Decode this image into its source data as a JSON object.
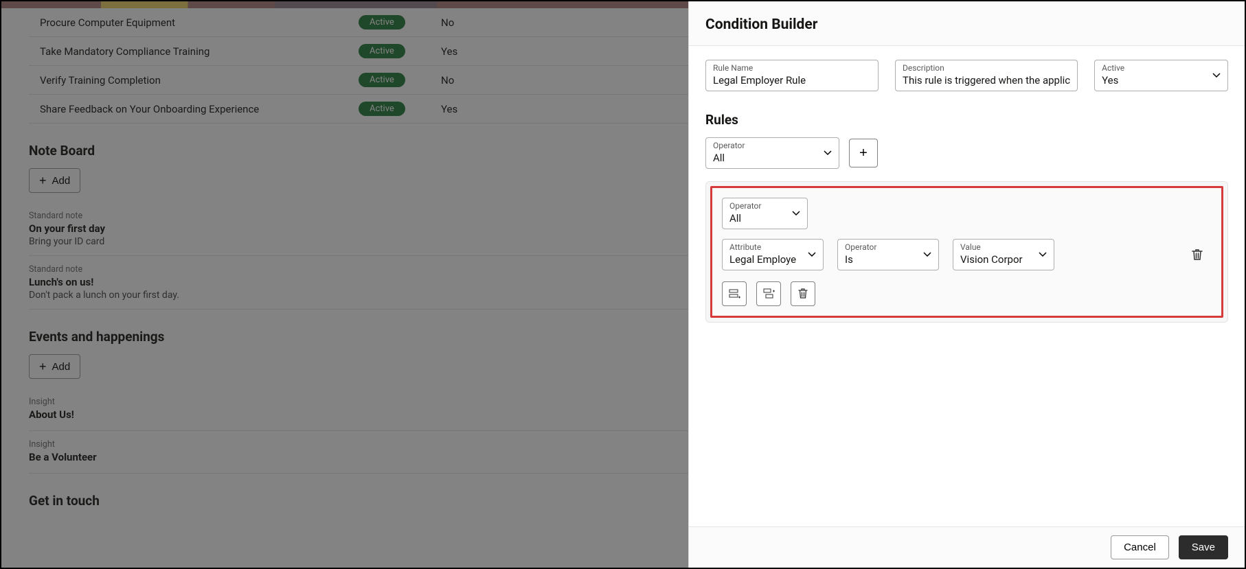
{
  "background": {
    "tasks": [
      {
        "name": "Procure Computer Equipment",
        "badge": "Active",
        "yn": "No"
      },
      {
        "name": "Take Mandatory Compliance Training",
        "badge": "Active",
        "yn": "Yes"
      },
      {
        "name": "Verify Training Completion",
        "badge": "Active",
        "yn": "No"
      },
      {
        "name": "Share Feedback on Your Onboarding Experience",
        "badge": "Active",
        "yn": "Yes"
      }
    ],
    "noteboard": {
      "title": "Note Board",
      "add": "Add",
      "items": [
        {
          "type": "Standard note",
          "title": "On your first day",
          "desc": "Bring your ID card"
        },
        {
          "type": "Standard note",
          "title": "Lunch's on us!",
          "desc": "Don't pack a lunch on your first day."
        }
      ]
    },
    "events": {
      "title": "Events and happenings",
      "add": "Add",
      "items": [
        {
          "type": "Insight",
          "title": "About Us!"
        },
        {
          "type": "Insight",
          "title": "Be a Volunteer"
        }
      ]
    },
    "getintouch": {
      "title": "Get in touch"
    }
  },
  "panel": {
    "title": "Condition Builder",
    "fields": {
      "ruleName": {
        "label": "Rule Name",
        "value": "Legal Employer Rule"
      },
      "description": {
        "label": "Description",
        "value": "This rule is triggered when the applic"
      },
      "active": {
        "label": "Active",
        "value": "Yes"
      }
    },
    "rules": {
      "title": "Rules",
      "operatorTop": {
        "label": "Operator",
        "value": "All"
      },
      "group": {
        "operator": {
          "label": "Operator",
          "value": "All"
        },
        "condition": {
          "attribute": {
            "label": "Attribute",
            "value": "Legal Employe"
          },
          "operator": {
            "label": "Operator",
            "value": "Is"
          },
          "value": {
            "label": "Value",
            "value": "Vision Corpor"
          }
        }
      }
    },
    "footer": {
      "cancel": "Cancel",
      "save": "Save"
    }
  }
}
